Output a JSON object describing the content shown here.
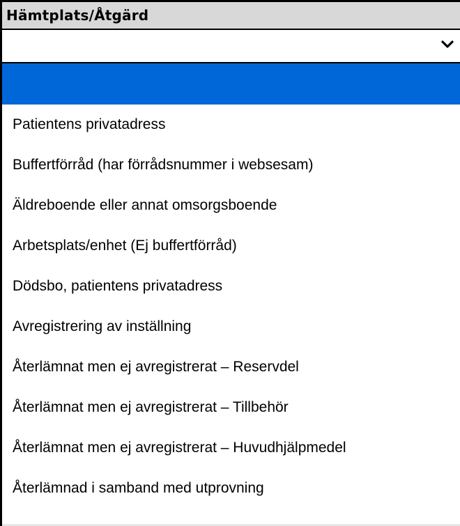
{
  "field": {
    "label": "Hämtplats/Åtgärd",
    "selected_value": ""
  },
  "icons": {
    "dropdown": "chevron-down-icon"
  },
  "colors": {
    "header_bg": "#d8d8d8",
    "highlight_bg": "#0067d9",
    "highlight_text": "#ffffff"
  },
  "options": [
    {
      "label": "",
      "highlighted": true
    },
    {
      "label": "Patientens privatadress",
      "highlighted": false
    },
    {
      "label": "Buffertförråd (har förrådsnummer i websesam)",
      "highlighted": false
    },
    {
      "label": "Äldreboende eller annat omsorgsboende",
      "highlighted": false
    },
    {
      "label": "Arbetsplats/enhet (Ej buffertförråd)",
      "highlighted": false
    },
    {
      "label": "Dödsbo, patientens privatadress",
      "highlighted": false
    },
    {
      "label": "Avregistrering av inställning",
      "highlighted": false
    },
    {
      "label": "Återlämnat men ej avregistrerat – Reservdel",
      "highlighted": false
    },
    {
      "label": "Återlämnat men ej avregistrerat – Tillbehör",
      "highlighted": false
    },
    {
      "label": "Återlämnat men ej avregistrerat – Huvudhjälpmedel",
      "highlighted": false
    },
    {
      "label": "Återlämnad i samband med utprovning",
      "highlighted": false
    }
  ]
}
